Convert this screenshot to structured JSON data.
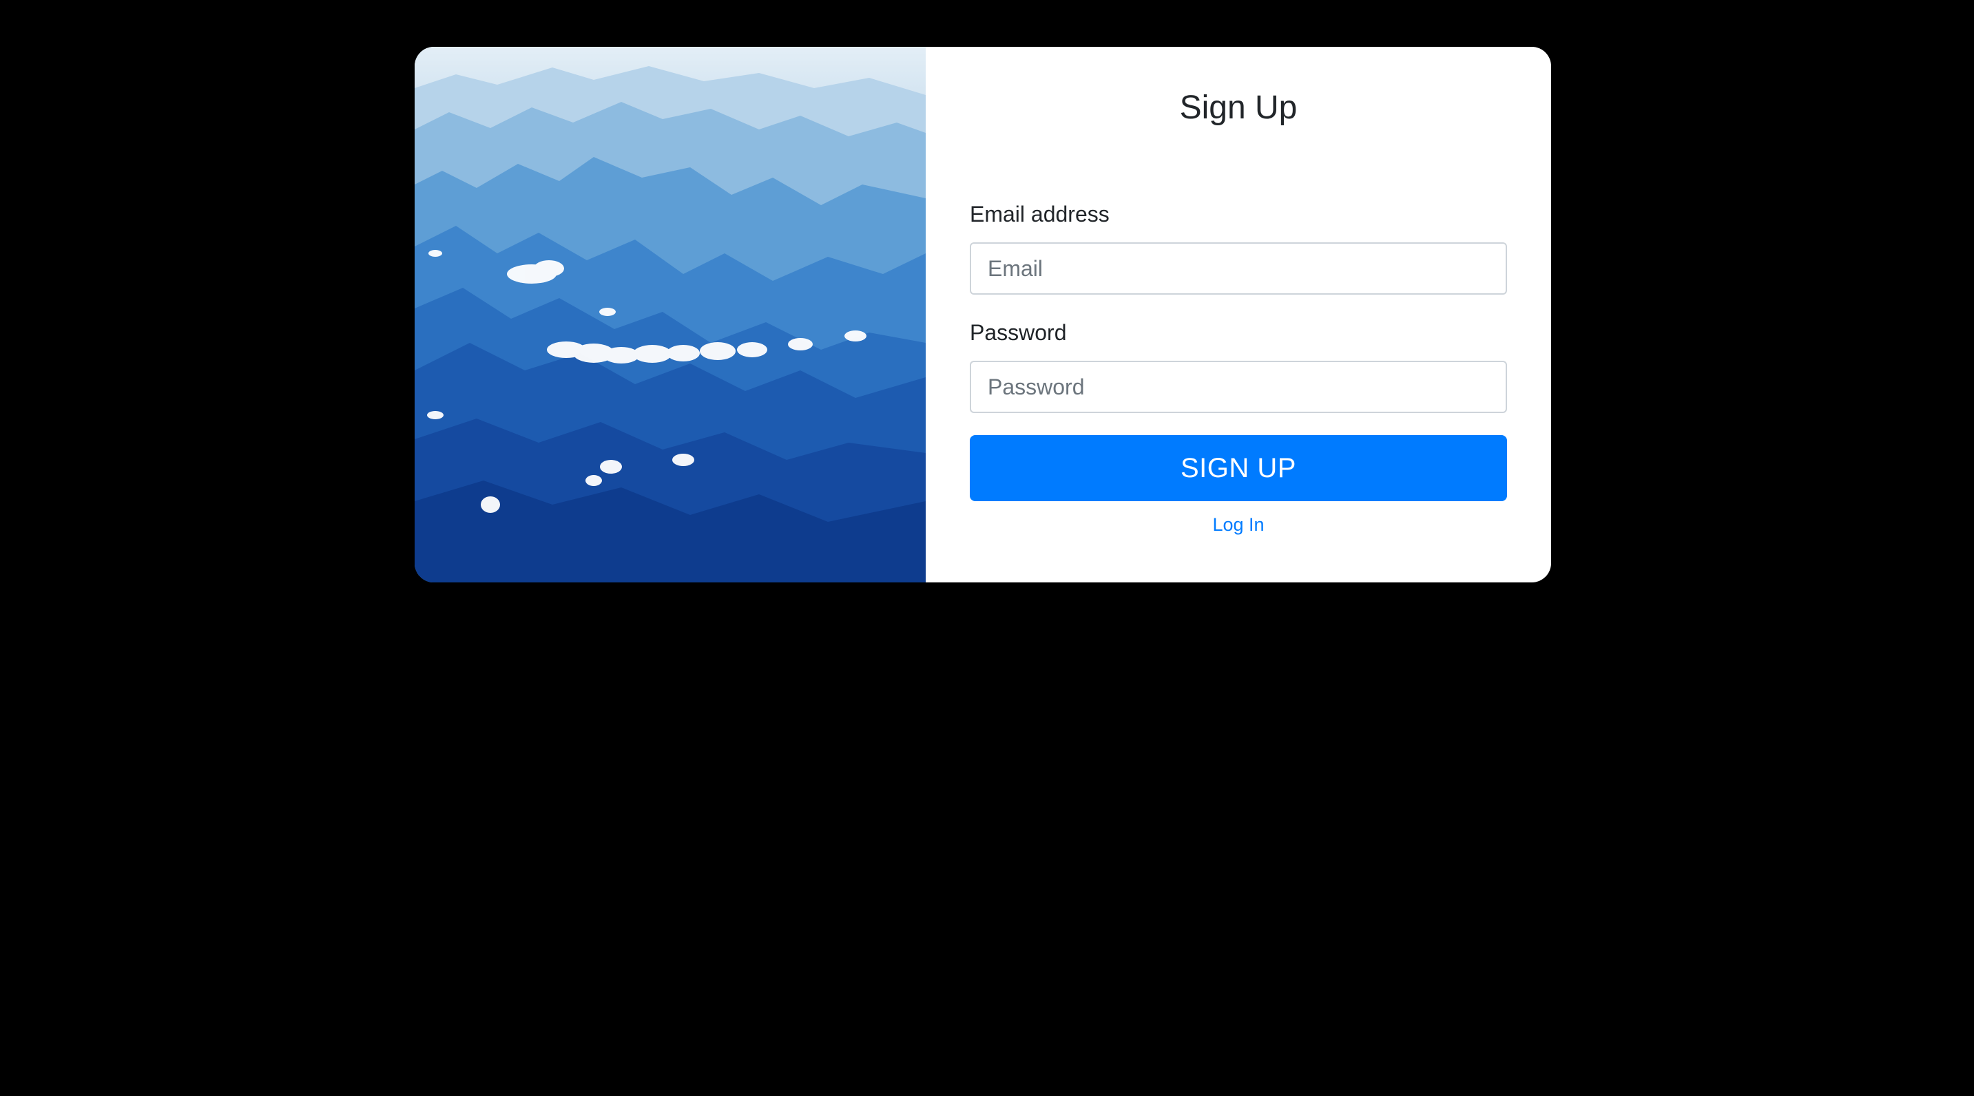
{
  "colors": {
    "background": "#000000",
    "card": "#ffffff",
    "primary": "#007bff",
    "text": "#212529",
    "input_border": "#ced4da",
    "placeholder": "#6c757d"
  },
  "hero_image": {
    "icon": "mountain-landscape-image",
    "palette": [
      "#dcebf5",
      "#7fb2dc",
      "#2f7fcb",
      "#1a53a8",
      "#0c2f7a"
    ]
  },
  "form": {
    "title": "Sign Up",
    "email": {
      "label": "Email address",
      "placeholder": "Email",
      "value": ""
    },
    "password": {
      "label": "Password",
      "placeholder": "Password",
      "value": ""
    },
    "submit_label": "SIGN UP",
    "login_link": "Log In"
  }
}
